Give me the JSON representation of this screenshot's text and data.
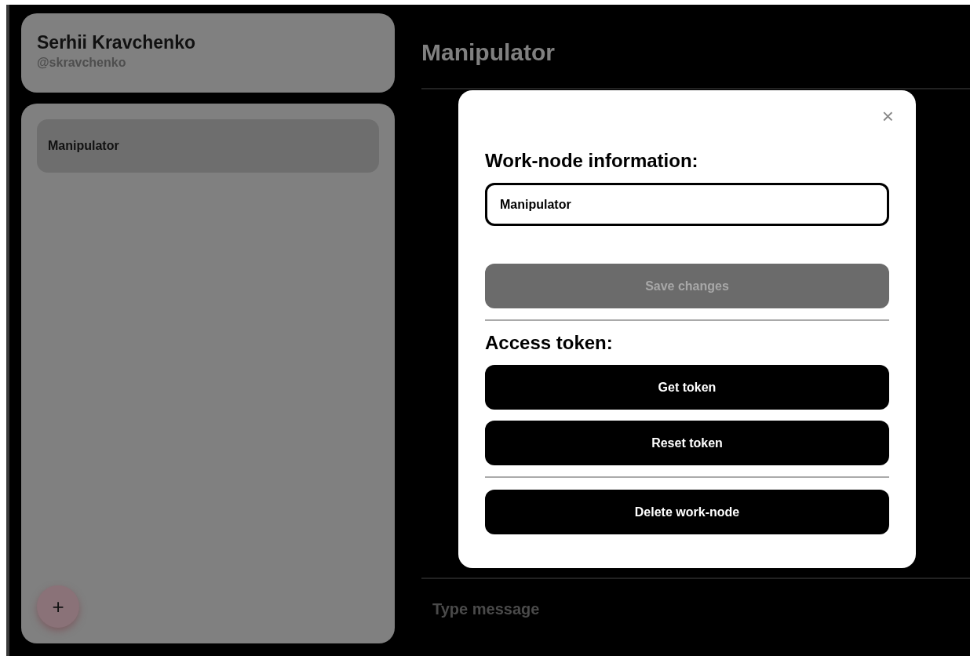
{
  "profile": {
    "name": "Serhii Kravchenko",
    "handle": "@skravchenko"
  },
  "sidebar": {
    "items": [
      {
        "label": "Manipulator",
        "selected": true
      }
    ],
    "add_button": "+"
  },
  "chat": {
    "title": "Manipulator",
    "message_placeholder": "Type message"
  },
  "modal": {
    "close": "×",
    "info_heading": "Work-node information:",
    "name_field": {
      "value": "Manipulator"
    },
    "save_button": {
      "label": "Save changes",
      "disabled": true
    },
    "token_heading": "Access token:",
    "token_buttons": [
      "Get token",
      "Reset token"
    ],
    "delete_button": "Delete work-node"
  }
}
